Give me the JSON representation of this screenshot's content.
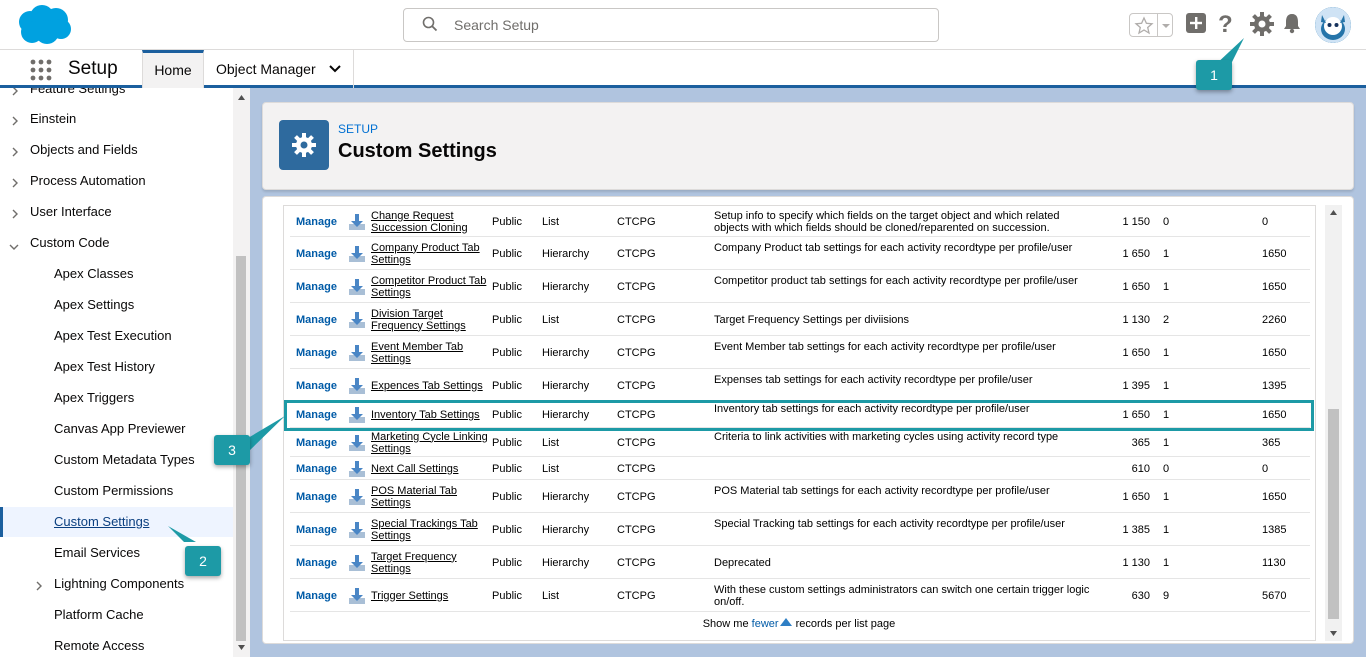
{
  "search": {
    "placeholder": "Search Setup"
  },
  "nav": {
    "app_name": "Setup",
    "tabs": [
      {
        "label": "Home"
      },
      {
        "label": "Object Manager"
      }
    ]
  },
  "sidebar": {
    "items": [
      {
        "label": "Feature Settings",
        "expandable": true
      },
      {
        "label": "Einstein",
        "expandable": true
      },
      {
        "label": "Objects and Fields",
        "expandable": true
      },
      {
        "label": "Process Automation",
        "expandable": true
      },
      {
        "label": "User Interface",
        "expandable": true
      },
      {
        "label": "Custom Code",
        "expanded": true
      },
      {
        "label": "Apex Classes"
      },
      {
        "label": "Apex Settings"
      },
      {
        "label": "Apex Test Execution"
      },
      {
        "label": "Apex Test History"
      },
      {
        "label": "Apex Triggers"
      },
      {
        "label": "Canvas App Previewer"
      },
      {
        "label": "Custom Metadata Types"
      },
      {
        "label": "Custom Permissions"
      },
      {
        "label": "Custom Settings",
        "active": true
      },
      {
        "label": "Email Services"
      },
      {
        "label": "Lightning Components",
        "expandable": true
      },
      {
        "label": "Platform Cache"
      },
      {
        "label": "Remote Access"
      }
    ]
  },
  "header": {
    "eyebrow": "SETUP",
    "title": "Custom Settings"
  },
  "table": {
    "manage_label": "Manage",
    "rows": [
      {
        "name": "Change Request Succession Cloning",
        "visibility": "Public",
        "type": "List",
        "namespace": "CTCPG",
        "description": "Setup info to specify which fields on the target object and which related objects with which fields should be cloned/reparented on succession.",
        "size": "1 150",
        "records": "0",
        "total": "0"
      },
      {
        "name": "Company Product Tab Settings",
        "visibility": "Public",
        "type": "Hierarchy",
        "namespace": "CTCPG",
        "description": "Company Product tab settings for each activity recordtype per profile/user",
        "size": "1 650",
        "records": "1",
        "total": "1650"
      },
      {
        "name": "Competitor Product Tab Settings",
        "visibility": "Public",
        "type": "Hierarchy",
        "namespace": "CTCPG",
        "description": "Competitor product tab settings for each activity recordtype per profile/user",
        "size": "1 650",
        "records": "1",
        "total": "1650"
      },
      {
        "name": "Division Target Frequency Settings",
        "visibility": "Public",
        "type": "List",
        "namespace": "CTCPG",
        "description": "Target Frequency Settings per diviisions",
        "size": "1 130",
        "records": "2",
        "total": "2260"
      },
      {
        "name": "Event Member Tab Settings",
        "visibility": "Public",
        "type": "Hierarchy",
        "namespace": "CTCPG",
        "description": "Event Member tab settings for each activity recordtype per profile/user",
        "size": "1 650",
        "records": "1",
        "total": "1650"
      },
      {
        "name": "Expences Tab Settings",
        "visibility": "Public",
        "type": "Hierarchy",
        "namespace": "CTCPG",
        "description": "Expenses tab settings for each activity recordtype per profile/user",
        "size": "1 395",
        "records": "1",
        "total": "1395"
      },
      {
        "name": "Inventory Tab Settings",
        "visibility": "Public",
        "type": "Hierarchy",
        "namespace": "CTCPG",
        "description": "Inventory tab settings for each activity recordtype per profile/user",
        "size": "1 650",
        "records": "1",
        "total": "1650",
        "highlighted": true
      },
      {
        "name": "Marketing Cycle Linking Settings",
        "visibility": "Public",
        "type": "List",
        "namespace": "CTCPG",
        "description": "Criteria to link activities with marketing cycles using activity record type",
        "size": "365",
        "records": "1",
        "total": "365"
      },
      {
        "name": "Next Call Settings",
        "visibility": "Public",
        "type": "List",
        "namespace": "CTCPG",
        "description": "",
        "size": "610",
        "records": "0",
        "total": "0"
      },
      {
        "name": "POS Material Tab Settings",
        "visibility": "Public",
        "type": "Hierarchy",
        "namespace": "CTCPG",
        "description": "POS Material tab settings for each activity recordtype per profile/user",
        "size": "1 650",
        "records": "1",
        "total": "1650"
      },
      {
        "name": "Special Trackings Tab Settings",
        "visibility": "Public",
        "type": "Hierarchy",
        "namespace": "CTCPG",
        "description": "Special Tracking tab settings for each activity recordtype per profile/user",
        "size": "1 385",
        "records": "1",
        "total": "1385"
      },
      {
        "name": "Target Frequency Settings",
        "visibility": "Public",
        "type": "Hierarchy",
        "namespace": "CTCPG",
        "description": "Deprecated",
        "size": "1 130",
        "records": "1",
        "total": "1130"
      },
      {
        "name": "Trigger Settings",
        "visibility": "Public",
        "type": "List",
        "namespace": "CTCPG",
        "description": "With these custom settings administrators can switch one certain trigger logic on/off.",
        "size": "630",
        "records": "9",
        "total": "5670"
      }
    ],
    "footer": {
      "pre": "Show me",
      "link": "fewer",
      "post": "records per list page"
    }
  },
  "annotations": {
    "badge_1": "1",
    "badge_2": "2",
    "badge_3": "3",
    "accent_color": "#1d9aa6"
  }
}
